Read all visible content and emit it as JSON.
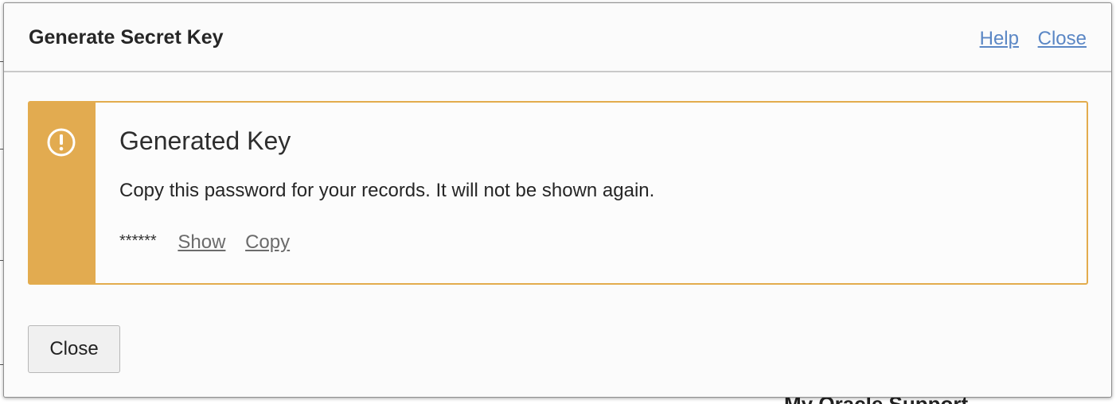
{
  "dialog": {
    "title": "Generate Secret Key",
    "header_links": {
      "help": "Help",
      "close": "Close"
    }
  },
  "notice": {
    "icon": "alert-circle-icon",
    "accent_color": "#e2ab50",
    "title": "Generated Key",
    "message": "Copy this password for your records. It will not be shown again.",
    "masked_key": "******",
    "show_link": "Show",
    "copy_link": "Copy"
  },
  "footer": {
    "close_button": "Close"
  },
  "background": {
    "partial_text": "My Oracle Support"
  }
}
